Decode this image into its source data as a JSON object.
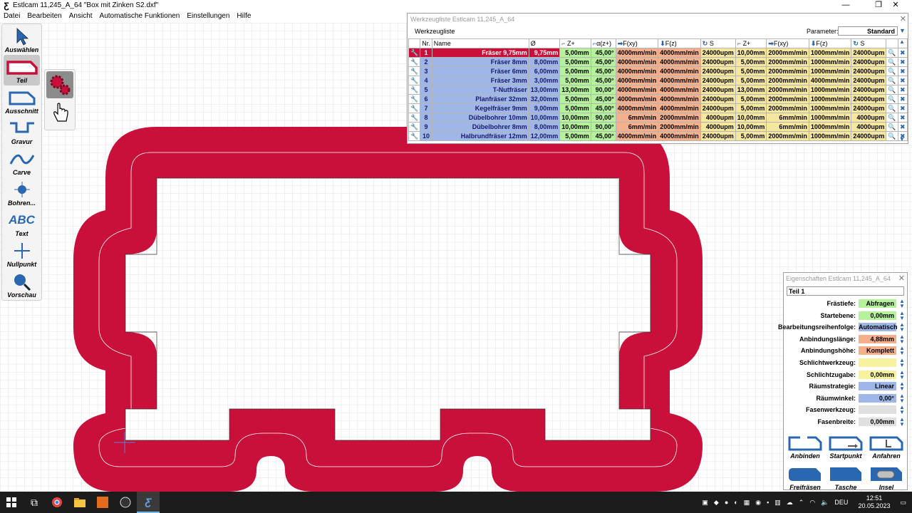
{
  "window": {
    "title": "Estlcam 11,245_A_64 \"Box mit Zinken S2.dxf\"",
    "minimize": "—",
    "maximize": "❐",
    "close": "✕"
  },
  "menu": [
    "Datei",
    "Bearbeiten",
    "Ansicht",
    "Automatische Funktionen",
    "Einstellungen",
    "Hilfe"
  ],
  "toolbar": [
    {
      "name": "auswaehlen",
      "label": "Auswählen"
    },
    {
      "name": "teil",
      "label": "Teil"
    },
    {
      "name": "ausschnitt",
      "label": "Ausschnitt"
    },
    {
      "name": "gravur",
      "label": "Gravur"
    },
    {
      "name": "carve",
      "label": "Carve"
    },
    {
      "name": "bohren",
      "label": "Bohren..."
    },
    {
      "name": "text",
      "label": "Text"
    },
    {
      "name": "nullpunkt",
      "label": "Nullpunkt"
    },
    {
      "name": "vorschau",
      "label": "Vorschau"
    }
  ],
  "text_tool_glyph": "ABC",
  "tool_window": {
    "title": "Werkzeugliste Estlcam 11,245_A_64",
    "tab": "Werkzeugliste",
    "parameter_label": "Parameter:",
    "parameter_value": "Standard",
    "headers": [
      "Nr.",
      "Name",
      "Ø",
      "Z+",
      "α(z+)",
      "F(xy)",
      "F(z)",
      "S",
      "Z+",
      "F(xy)",
      "F(z)",
      "S"
    ],
    "rows": [
      [
        "1",
        "Fräser 9,75mm",
        "9,75mm",
        "5,00mm",
        "45,00°",
        "4000mm/min",
        "4000mm/min",
        "24000upm",
        "10,00mm",
        "2000mm/min",
        "1000mm/min",
        "24000upm"
      ],
      [
        "2",
        "Fräser 8mm",
        "8,00mm",
        "5,00mm",
        "45,00°",
        "4000mm/min",
        "4000mm/min",
        "24000upm",
        "5,00mm",
        "2000mm/min",
        "1000mm/min",
        "24000upm"
      ],
      [
        "3",
        "Fräser 6mm",
        "6,00mm",
        "5,00mm",
        "45,00°",
        "4000mm/min",
        "4000mm/min",
        "24000upm",
        "5,00mm",
        "2000mm/min",
        "1000mm/min",
        "24000upm"
      ],
      [
        "4",
        "Fräser 3mm",
        "3,00mm",
        "5,00mm",
        "45,00°",
        "4000mm/min",
        "4000mm/min",
        "24000upm",
        "5,00mm",
        "2000mm/min",
        "4000mm/min",
        "24000upm"
      ],
      [
        "5",
        "T-Nutfräser",
        "13,00mm",
        "13,00mm",
        "90,00°",
        "4000mm/min",
        "4000mm/min",
        "24000upm",
        "13,00mm",
        "2000mm/min",
        "1000mm/min",
        "24000upm"
      ],
      [
        "6",
        "Planfräser 32mm",
        "32,00mm",
        "5,00mm",
        "45,00°",
        "4000mm/min",
        "4000mm/min",
        "24000upm",
        "5,00mm",
        "2000mm/min",
        "1000mm/min",
        "24000upm"
      ],
      [
        "7",
        "Kegelfräser 9mm",
        "9,00mm",
        "5,00mm",
        "45,00°",
        "4000mm/min",
        "4000mm/min",
        "24000upm",
        "5,00mm",
        "2000mm/min",
        "1000mm/min",
        "24000upm"
      ],
      [
        "8",
        "Dübelbohrer 10mm",
        "10,00mm",
        "10,00mm",
        "90,00°",
        "6mm/min",
        "2000mm/min",
        "4000upm",
        "10,00mm",
        "6mm/min",
        "1000mm/min",
        "4000upm"
      ],
      [
        "9",
        "Dübelbohrer 8mm",
        "8,00mm",
        "10,00mm",
        "90,00°",
        "6mm/min",
        "2000mm/min",
        "4000upm",
        "10,00mm",
        "6mm/min",
        "1000mm/min",
        "4000upm"
      ],
      [
        "10",
        "Halbrundfräser 12mm",
        "12,00mm",
        "5,00mm",
        "45,00°",
        "4000mm/min",
        "4000mm/min",
        "24000upm",
        "5,00mm",
        "2000mm/min",
        "1000mm/min",
        "24000upm"
      ]
    ]
  },
  "properties": {
    "title": "Eigenschaften Estlcam 11,245_A_64",
    "part_name": "Teil 1",
    "rows": [
      {
        "label": "Frästiefe:",
        "value": "Abfragen",
        "color": "#b5f29b"
      },
      {
        "label": "Startebene:",
        "value": "0,00mm",
        "color": "#b5f29b"
      },
      {
        "label": "Bearbeitungsreihenfolge:",
        "value": "Automatisch",
        "color": "#9fb7e8"
      },
      {
        "label": "Anbindungslänge:",
        "value": "4,88mm",
        "color": "#f4b08d"
      },
      {
        "label": "Anbindungshöhe:",
        "value": "Komplett",
        "color": "#f4b08d"
      },
      {
        "label": "Schlichtwerkzeug:",
        "value": "",
        "color": "#f6f29e"
      },
      {
        "label": "Schlichtzugabe:",
        "value": "0,00mm",
        "color": "#f6f29e"
      },
      {
        "label": "Räumstrategie:",
        "value": "Linear",
        "color": "#9fb7e8"
      },
      {
        "label": "Räumwinkel:",
        "value": "0,00°",
        "color": "#9fb7e8"
      },
      {
        "label": "Fasenwerkzeug:",
        "value": "",
        "color": "#e0e0e0"
      },
      {
        "label": "Fasenbreite:",
        "value": "0,00mm",
        "color": "#e0e0e0"
      }
    ],
    "buttons": [
      "Anbinden",
      "Startpunkt",
      "Anfahren",
      "Freifräsen",
      "Tasche",
      "Insel"
    ]
  },
  "taskbar": {
    "language": "DEU",
    "time": "12:51",
    "date": "20.05.2023"
  },
  "colors": {
    "part_fill": "#c8103a",
    "accent_blue": "#2a67b1",
    "grid": "#d9d9d9"
  }
}
